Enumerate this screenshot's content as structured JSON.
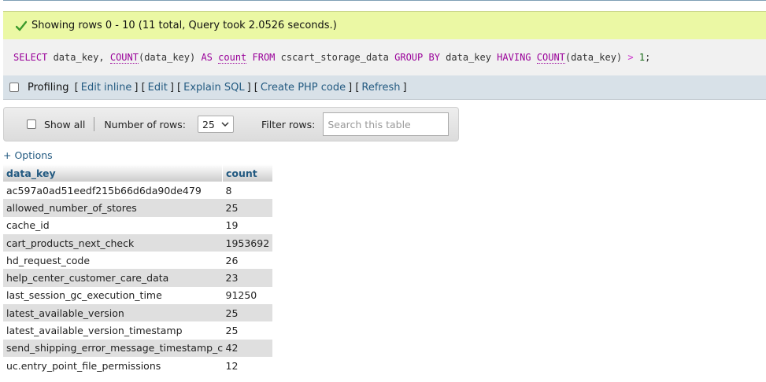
{
  "message": {
    "text": "Showing rows 0 - 10 (11 total, Query took 2.0526 seconds.)",
    "icon": "checkmark-icon"
  },
  "sql": {
    "t1": "SELECT",
    "t2": " data_key, ",
    "t3": "COUNT",
    "t4": "(data_key) ",
    "t5": "AS",
    "t6": " ",
    "t7": "count",
    "t8": " ",
    "t9": "FROM",
    "t10": " cscart_storage_data ",
    "t11": "GROUP BY",
    "t12": " data_key ",
    "t13": "HAVING",
    "t14": " ",
    "t15": "COUNT",
    "t16": "(data_key) ",
    "t17": ">",
    "t18": " ",
    "t19": "1",
    "t20": ";"
  },
  "toolbar": {
    "profiling": "Profiling",
    "edit_inline": "Edit inline",
    "edit": "Edit",
    "explain_sql": "Explain SQL",
    "create_php": "Create PHP code",
    "refresh": "Refresh"
  },
  "nav": {
    "show_all": "Show all",
    "num_rows_label": "Number of rows:",
    "num_rows_value": "25",
    "filter_label": "Filter rows:",
    "search_placeholder": "Search this table"
  },
  "options_link": "+ Options",
  "table": {
    "headers": [
      "data_key",
      "count"
    ],
    "rows": [
      {
        "data_key": "ac597a0ad51eedf215b66d6da90de479",
        "count": "8"
      },
      {
        "data_key": "allowed_number_of_stores",
        "count": "25"
      },
      {
        "data_key": "cache_id",
        "count": "19"
      },
      {
        "data_key": "cart_products_next_check",
        "count": "1953692"
      },
      {
        "data_key": "hd_request_code",
        "count": "26"
      },
      {
        "data_key": "help_center_customer_care_data",
        "count": "23"
      },
      {
        "data_key": "last_session_gc_execution_time",
        "count": "91250"
      },
      {
        "data_key": "latest_available_version",
        "count": "25"
      },
      {
        "data_key": "latest_available_version_timestamp",
        "count": "25"
      },
      {
        "data_key": "send_shipping_error_message_timestamp_can",
        "count": "42"
      },
      {
        "data_key": "uc.entry_point_file_permissions",
        "count": "12"
      }
    ]
  }
}
